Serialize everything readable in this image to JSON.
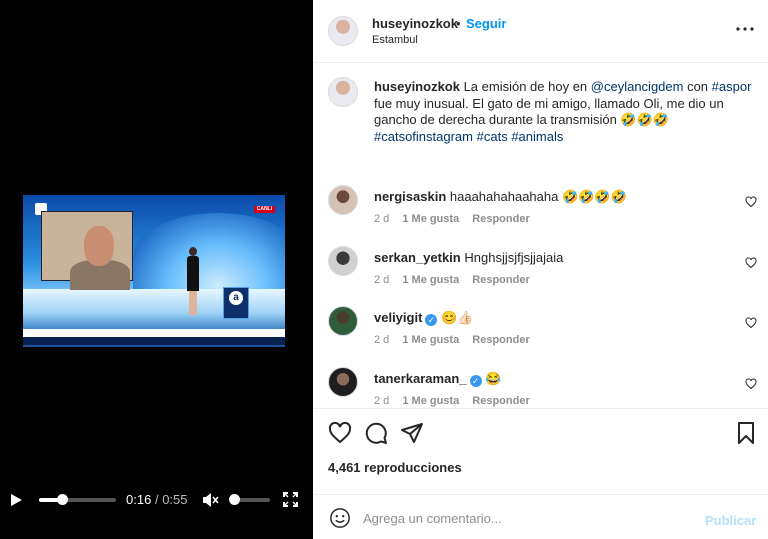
{
  "video": {
    "current_time": "0:16",
    "separator": "/",
    "duration": "0:55",
    "progress_fraction": 0.3,
    "volume_fraction": 0.05,
    "overlay": {
      "live_badge": "CANLI",
      "desk_logo": "a"
    }
  },
  "post": {
    "author": "huseyinozkok",
    "dot": "•",
    "follow_label": "Seguir",
    "location": "Estambul",
    "caption": {
      "author": "huseyinozkok",
      "text_1": " La emisión de hoy en ",
      "mention": "@ceylancigdem",
      "text_2": " con ",
      "tag_aspor": "#aspor",
      "text_3": " fue muy inusual. El gato de mi amigo, llamado Oli, me dio un gancho de derecha durante la transmisión 🤣🤣🤣",
      "tag_1": "#catsofinstagram",
      "tag_2": "#cats",
      "tag_3": "#animals"
    },
    "comments": [
      {
        "user": "nergisaskin",
        "text": "haaahahahaahaha 🤣🤣🤣🤣",
        "age": "2 d",
        "likes": "1 Me gusta",
        "reply": "Responder"
      },
      {
        "user": "serkan_yetkin",
        "text": "Hnghsjjsjfjsjjajaia",
        "age": "2 d",
        "likes": "1 Me gusta",
        "reply": "Responder"
      },
      {
        "user": "veliyigit",
        "text": "😊👍🏻",
        "age": "2 d",
        "likes": "1 Me gusta",
        "reply": "Responder",
        "verified": true
      },
      {
        "user": "tanerkaraman_",
        "text": "😂",
        "age": "2 d",
        "likes": "1 Me gusta",
        "reply": "Responder",
        "verified": true
      }
    ],
    "views_count": "4,461",
    "views_label": "reproducciones",
    "comment_placeholder": "Agrega un comentario...",
    "publish_label": "Publicar",
    "colors": {
      "link": "#00376b",
      "follow": "#0095f6",
      "publish_disabled": "#b2dffc",
      "verified": "#3897f0"
    }
  }
}
